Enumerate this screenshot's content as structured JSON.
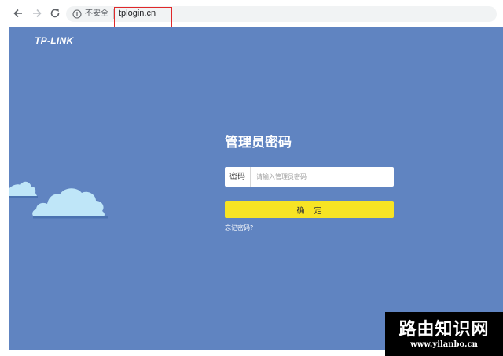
{
  "browser": {
    "security_label": "不安全",
    "url": "tplogin.cn",
    "icons": [
      "back-arrow-icon",
      "forward-arrow-icon",
      "reload-icon",
      "info-icon"
    ]
  },
  "page": {
    "logo": "TP-LINK",
    "title": "管理员密码",
    "password_label": "密码",
    "password_placeholder": "请输入管理员密码",
    "password_value": "",
    "confirm_label": "确定",
    "forgot_link": "忘记密码?"
  },
  "watermark": {
    "title": "路由知识网",
    "url": "www.yilanbo.cn"
  },
  "colors": {
    "page_background": "#6084c1",
    "button": "#f7e424",
    "highlight_box": "#e0282a",
    "cloud": "#bfe6f8"
  }
}
